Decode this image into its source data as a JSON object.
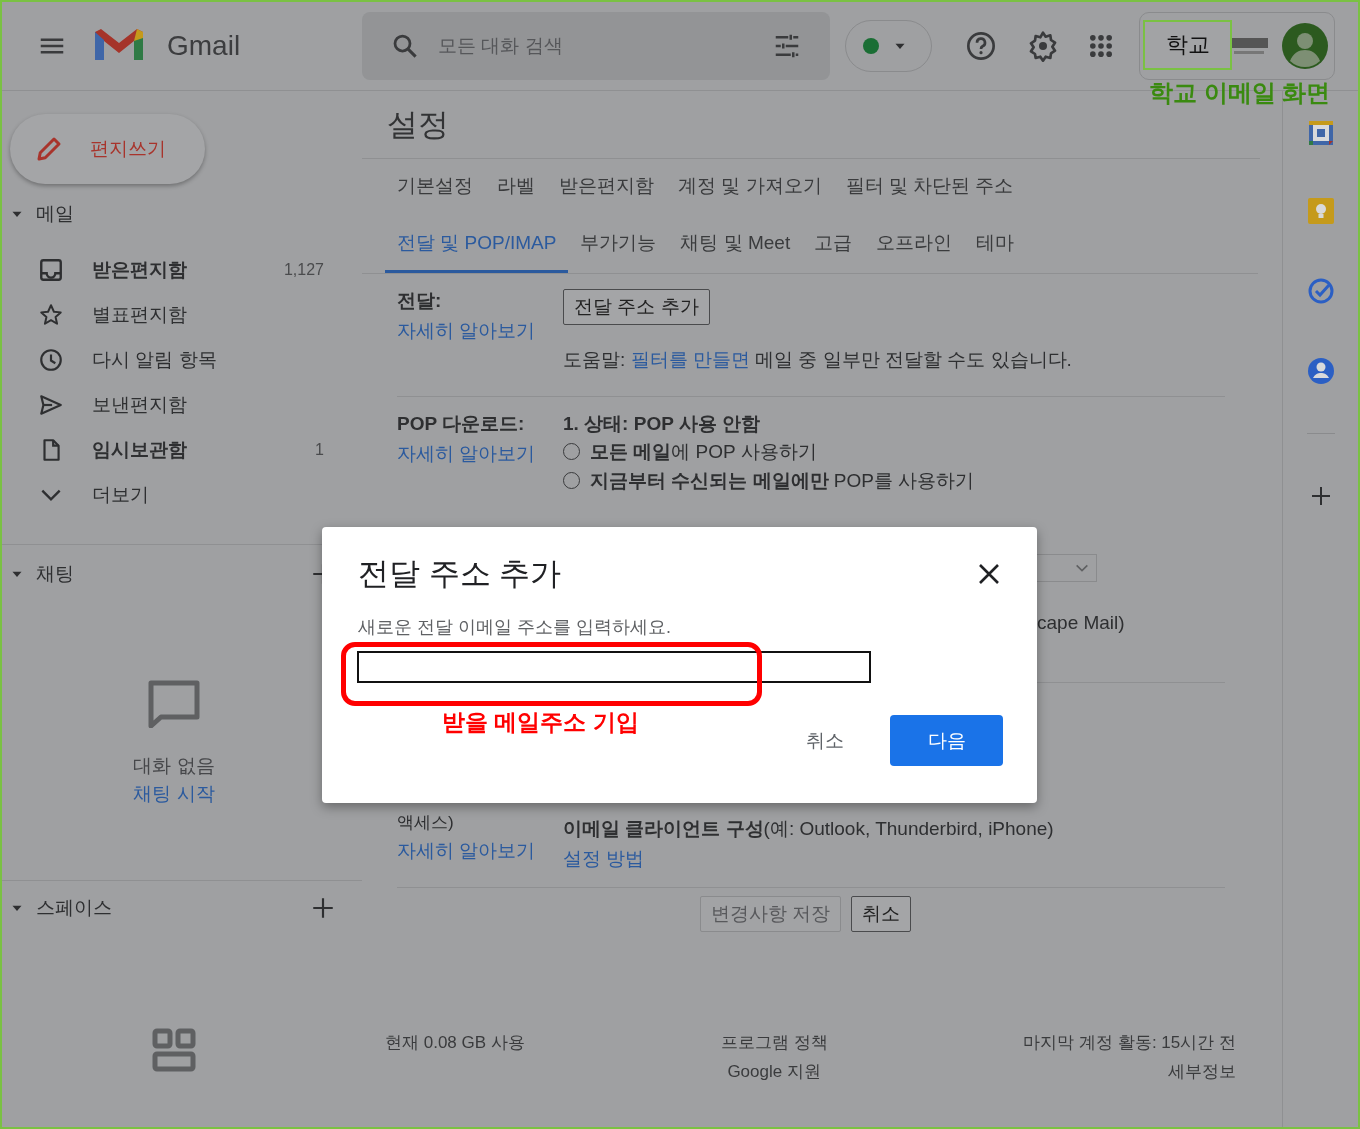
{
  "header": {
    "app_name": "Gmail",
    "search": {
      "placeholder": "모든 대화 검색"
    },
    "status": {
      "online": true
    }
  },
  "sidebar": {
    "compose": "편지쓰기",
    "mail": {
      "label": "메일",
      "expanded": true,
      "folders": [
        {
          "label": "받은편지함",
          "count": "1,127",
          "unread": true
        },
        {
          "label": "별표편지함",
          "unread": false
        },
        {
          "label": "다시 알림 항목",
          "unread": false
        },
        {
          "label": "보낸편지함",
          "unread": false
        },
        {
          "label": "임시보관함",
          "count": "1",
          "unread": true
        },
        {
          "label": "더보기",
          "unread": false
        }
      ]
    },
    "chat": {
      "label": "채팅",
      "expanded": true,
      "empty_text": "대화 없음",
      "start_link": "채팅 시작"
    },
    "spaces": {
      "label": "스페이스",
      "expanded": true
    }
  },
  "settings": {
    "title": "설정",
    "tab_rows": [
      [
        {
          "label": "기본설정",
          "selected": false
        },
        {
          "label": "라벨",
          "selected": false
        },
        {
          "label": "받은편지함",
          "selected": false
        },
        {
          "label": "계정 및 가져오기",
          "selected": false
        },
        {
          "label": "필터 및 차단된 주소",
          "selected": false
        }
      ],
      [
        {
          "label": "전달 및 POP/IMAP",
          "selected": true
        },
        {
          "label": "부가기능",
          "selected": false
        },
        {
          "label": "채팅 및 Meet",
          "selected": false
        },
        {
          "label": "고급",
          "selected": false
        },
        {
          "label": "오프라인",
          "selected": false
        },
        {
          "label": "테마",
          "selected": false
        }
      ]
    ],
    "forwarding": {
      "label": "전달:",
      "learn_more": "자세히 알아보기",
      "add_button": "전달 주소 추가",
      "help_prefix": "도움말:",
      "help_link": "필터를 만들면",
      "help_suffix": "메일 중 일부만 전달할 수도 있습니다."
    },
    "pop": {
      "label": "POP 다운로드:",
      "learn_more": "자세히 알아보기",
      "status": "1. 상태: POP 사용 안함",
      "options": [
        {
          "label": "**모든 메일**에 POP 사용하기",
          "selected": false
        },
        {
          "label": "**지금부터 수신되는 메일에만** POP를 사용하기",
          "selected": false
        }
      ],
      "client_text": "cape Mail)"
    },
    "imap": {
      "label": "액세스)",
      "learn_more": "자세히 알아보기",
      "client_text": "**이메일 클라이언트 구성**(예: Outlook, Thunderbird, iPhone)",
      "setup_link": "설정 방법"
    },
    "actions": {
      "save": {
        "label": "변경사항 저장",
        "disabled": true
      },
      "cancel": "취소"
    }
  },
  "footer": {
    "storage": "현재 0.08 GB 사용",
    "policy": "프로그램 정책",
    "support": "Google 지원",
    "activity": "마지막 계정 활동: 15시간 전",
    "details": "세부정보"
  },
  "dialog": {
    "title": "전달 주소 추가",
    "prompt": "새로운 전달 이메일 주소를 입력하세요.",
    "cancel": "취소",
    "next": "다음"
  },
  "annotations": [
    {
      "kind": "label-box",
      "text": "학교",
      "color": "#7ac143"
    },
    {
      "kind": "caption",
      "text": "학교 이메일 화면",
      "color": "#3a8a10"
    },
    {
      "kind": "highlight",
      "color": "#ff0000"
    },
    {
      "kind": "caption",
      "text": "받을 메일주소 기입",
      "color": "#ff0000"
    }
  ]
}
